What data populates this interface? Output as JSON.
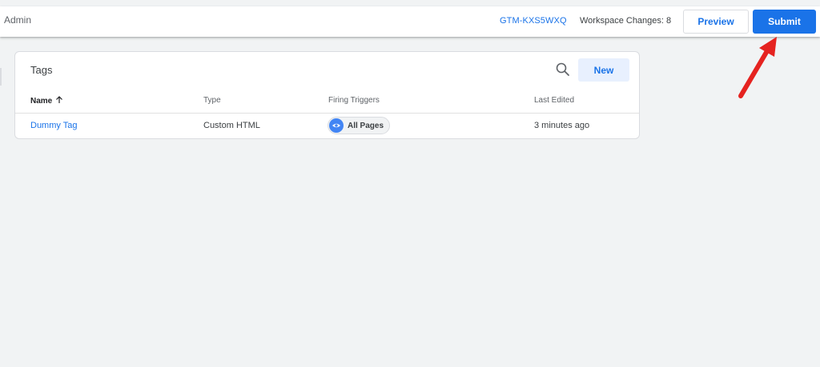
{
  "header": {
    "admin_label": "Admin",
    "container_id": "GTM-KXS5WXQ",
    "workspace_changes": "Workspace Changes: 8",
    "preview_label": "Preview",
    "submit_label": "Submit"
  },
  "tags_card": {
    "title": "Tags",
    "search_icon": "search-icon",
    "new_label": "New",
    "columns": {
      "name": "Name",
      "type": "Type",
      "firing_triggers": "Firing Triggers",
      "last_edited": "Last Edited"
    },
    "rows": [
      {
        "name": "Dummy Tag",
        "type": "Custom HTML",
        "trigger": "All Pages",
        "trigger_icon": "eye-icon",
        "last_edited": "3 minutes ago"
      }
    ]
  },
  "colors": {
    "accent": "#1a73e8",
    "background": "#f1f3f4",
    "annotation_arrow": "#e52320"
  }
}
